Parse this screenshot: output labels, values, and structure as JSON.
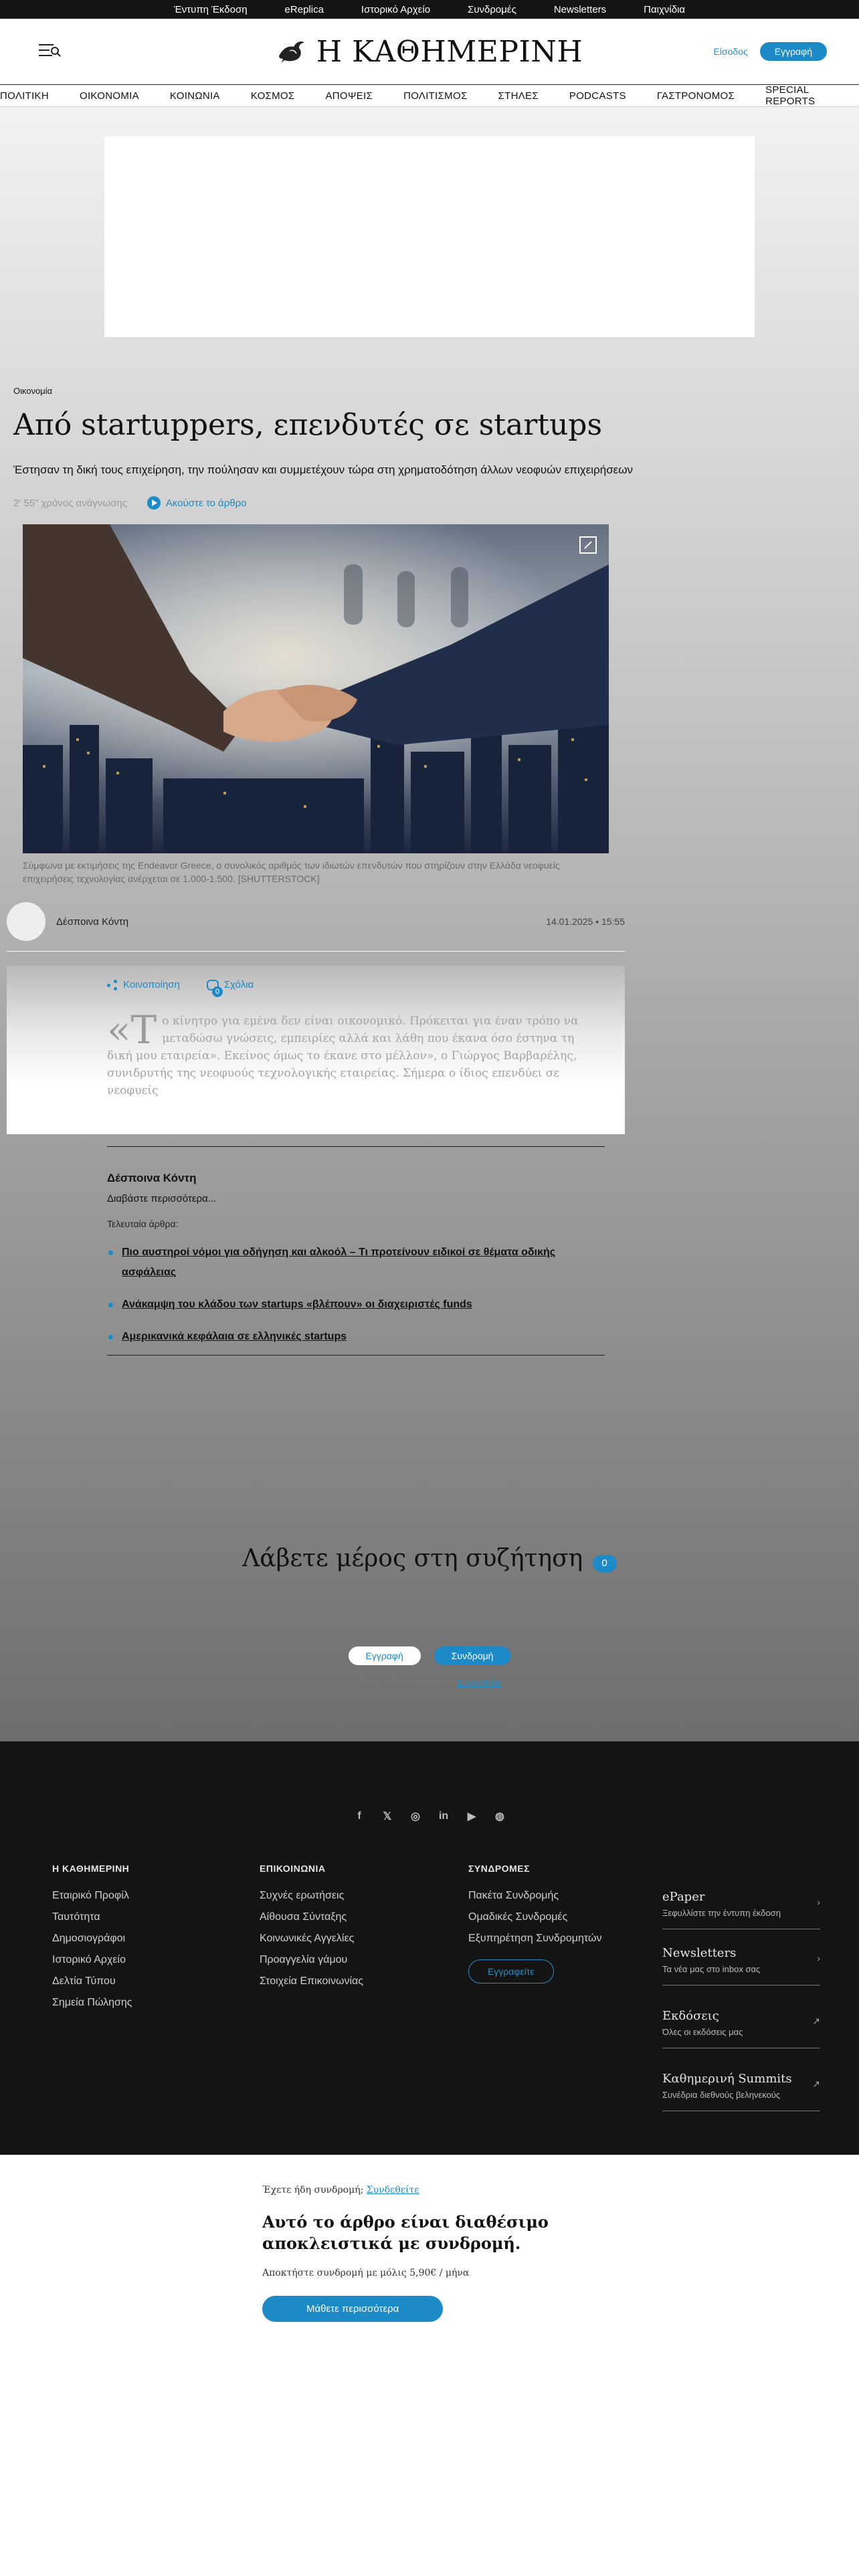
{
  "topbar": {
    "items": [
      "Έντυπη Έκδοση",
      "eReplica",
      "Ιστορικό Αρχείο",
      "Συνδρομές",
      "Newsletters",
      "Παιχνίδια"
    ]
  },
  "header": {
    "logo_text": "Η ΚΑΘΗΜΕΡΙΝΗ",
    "login": "Είσοδος",
    "register": "Εγγραφή",
    "menu_icon": "menu-search-icon"
  },
  "nav": {
    "items": [
      "ΠΟΛΙΤΙΚΗ",
      "ΟΙΚΟΝΟΜΙΑ",
      "ΚΟΙΝΩΝΙΑ",
      "ΚΟΣΜΟΣ",
      "ΑΠΟΨΕΙΣ",
      "ΠΟΛΙΤΙΣΜΟΣ",
      "ΣΤΗΛΕΣ",
      "PODCASTS",
      "ΓΑΣΤΡΟΝΟΜΟΣ",
      "SPECIAL REPORTS"
    ]
  },
  "article": {
    "category": "Οικονομία",
    "title": "Από startuppers, επενδυτές σε startups",
    "subtitle": "Έστησαν τη δική τους επιχείρηση, την πούλησαν και συμμετέχουν τώρα στη χρηματοδότηση άλλων νεοφυών επιχειρήσεων",
    "read_time": "2' 55\" χρόνος ανάγνωσης",
    "listen": "Ακούστε το άρθρο",
    "caption": "Σύμφωνα με εκτιμήσεις της Endeavor Greece, ο συνολικός αριθμός των ιδιωτών επενδυτών που στηρίζουν στην Ελλάδα νεοφυείς επιχειρήσεις τεχνολογίας ανέρχεται σε 1.000-1.500. [SHUTTERSTOCK]",
    "author": "Δέσποινα Κόντη",
    "date": "14.01.2025 • 15:55",
    "share": "Κοινοποίηση",
    "comments": "Σχόλια",
    "comments_count": "0",
    "dropcap": "Τ",
    "lead": "ο κίνητρο για εμένα δεν είναι οικονομικό. Πρόκειται για έναν τρόπο να μεταδώσω γνώσεις, εμπειρίες αλλά και λάθη που έκανα όσο έστηνα τη δική μου εταιρεία». Εκείνος όμως το έκανε στο μέλλον», ο Γιώργος Βαρβαρέλης, συνιδρυτής της νεοφυούς τεχνολογικής εταιρείας. Σήμερα ο ίδιος επενδύει σε νεοφυείς",
    "quote_mark": "«"
  },
  "bio": {
    "name": "Δέσποινα Κόντη",
    "read_more": "Διαβάστε περισσότερα...",
    "latest_label": "Τελευταία άρθρα:",
    "latest": [
      "Πιο αυστηροί νόμοι για οδήγηση και αλκοόλ – Τι προτείνουν ειδικοί σε θέματα οδικής ασφάλειας",
      "Ανάκαμψη του κλάδου των startups «βλέπουν» οι διαχειριστές funds",
      "Αμερικανικά κεφάλαια σε ελληνικές startups"
    ]
  },
  "discussion": {
    "title": "Λάβετε μέρος στη συζήτηση",
    "count": "0",
    "register": "Εγγραφή",
    "subscribe": "Συνδρομή",
    "have_account": "Έχετε ήδη λογαριασμό;",
    "login": "Συνδεθείτε"
  },
  "footer": {
    "social": [
      "f",
      "𝕏",
      "◎",
      "in",
      "▶",
      "◍"
    ],
    "col1": {
      "title": "Η ΚΑΘΗΜΕΡΙΝΗ",
      "items": [
        "Εταιρικό Προφίλ",
        "Ταυτότητα",
        "Δημοσιογράφοι",
        "Ιστορικό Αρχείο",
        "Δελτία Τύπου",
        "Σημεία Πώλησης"
      ]
    },
    "col2": {
      "title": "ΕΠΙΚΟΙΝΩΝΙΑ",
      "items": [
        "Συχνές ερωτήσεις",
        "Αίθουσα Σύνταξης",
        "Κοινωνικές Αγγελίες",
        "Προαγγελία γάμου",
        "Στοιχεία Επικοινωνίας"
      ]
    },
    "col3": {
      "title": "ΣΥΝΔΡΟΜΕΣ",
      "items": [
        "Πακέτα Συνδρομής",
        "Ομαδικές Συνδρομές",
        "Εξυπηρέτηση Συνδρομητών"
      ],
      "button": "Εγγραφείτε"
    },
    "cards": [
      {
        "title": "ePaper",
        "sub": "Ξεφυλλίστε την έντυπη έκδοση",
        "arrow": "›"
      },
      {
        "title": "Newsletters",
        "sub": "Τα νέα μας στο inbox σας",
        "arrow": "›"
      },
      {
        "title": "Εκδόσεις",
        "sub": "Όλες οι εκδόσεις μας",
        "arrow": "↗"
      },
      {
        "title": "Καθημερινή Summits",
        "sub": "Συνέδρια διεθνούς βεληνεκούς",
        "arrow": "↗"
      }
    ]
  },
  "paywall": {
    "have_sub": "Έχετε ήδη συνδρομή;",
    "login": "Συνδεθείτε",
    "title": "Αυτό το άρθρο είναι διαθέσιμο αποκλειστικά με συνδρομή.",
    "price": "Αποκτήστε συνδρομή με μόλις 5,90€ / μήνα",
    "button": "Μάθετε περισσότερα"
  },
  "colors": {
    "accent": "#1b8ac6",
    "footer_bg": "#141414",
    "topbar_bg": "#141414"
  }
}
